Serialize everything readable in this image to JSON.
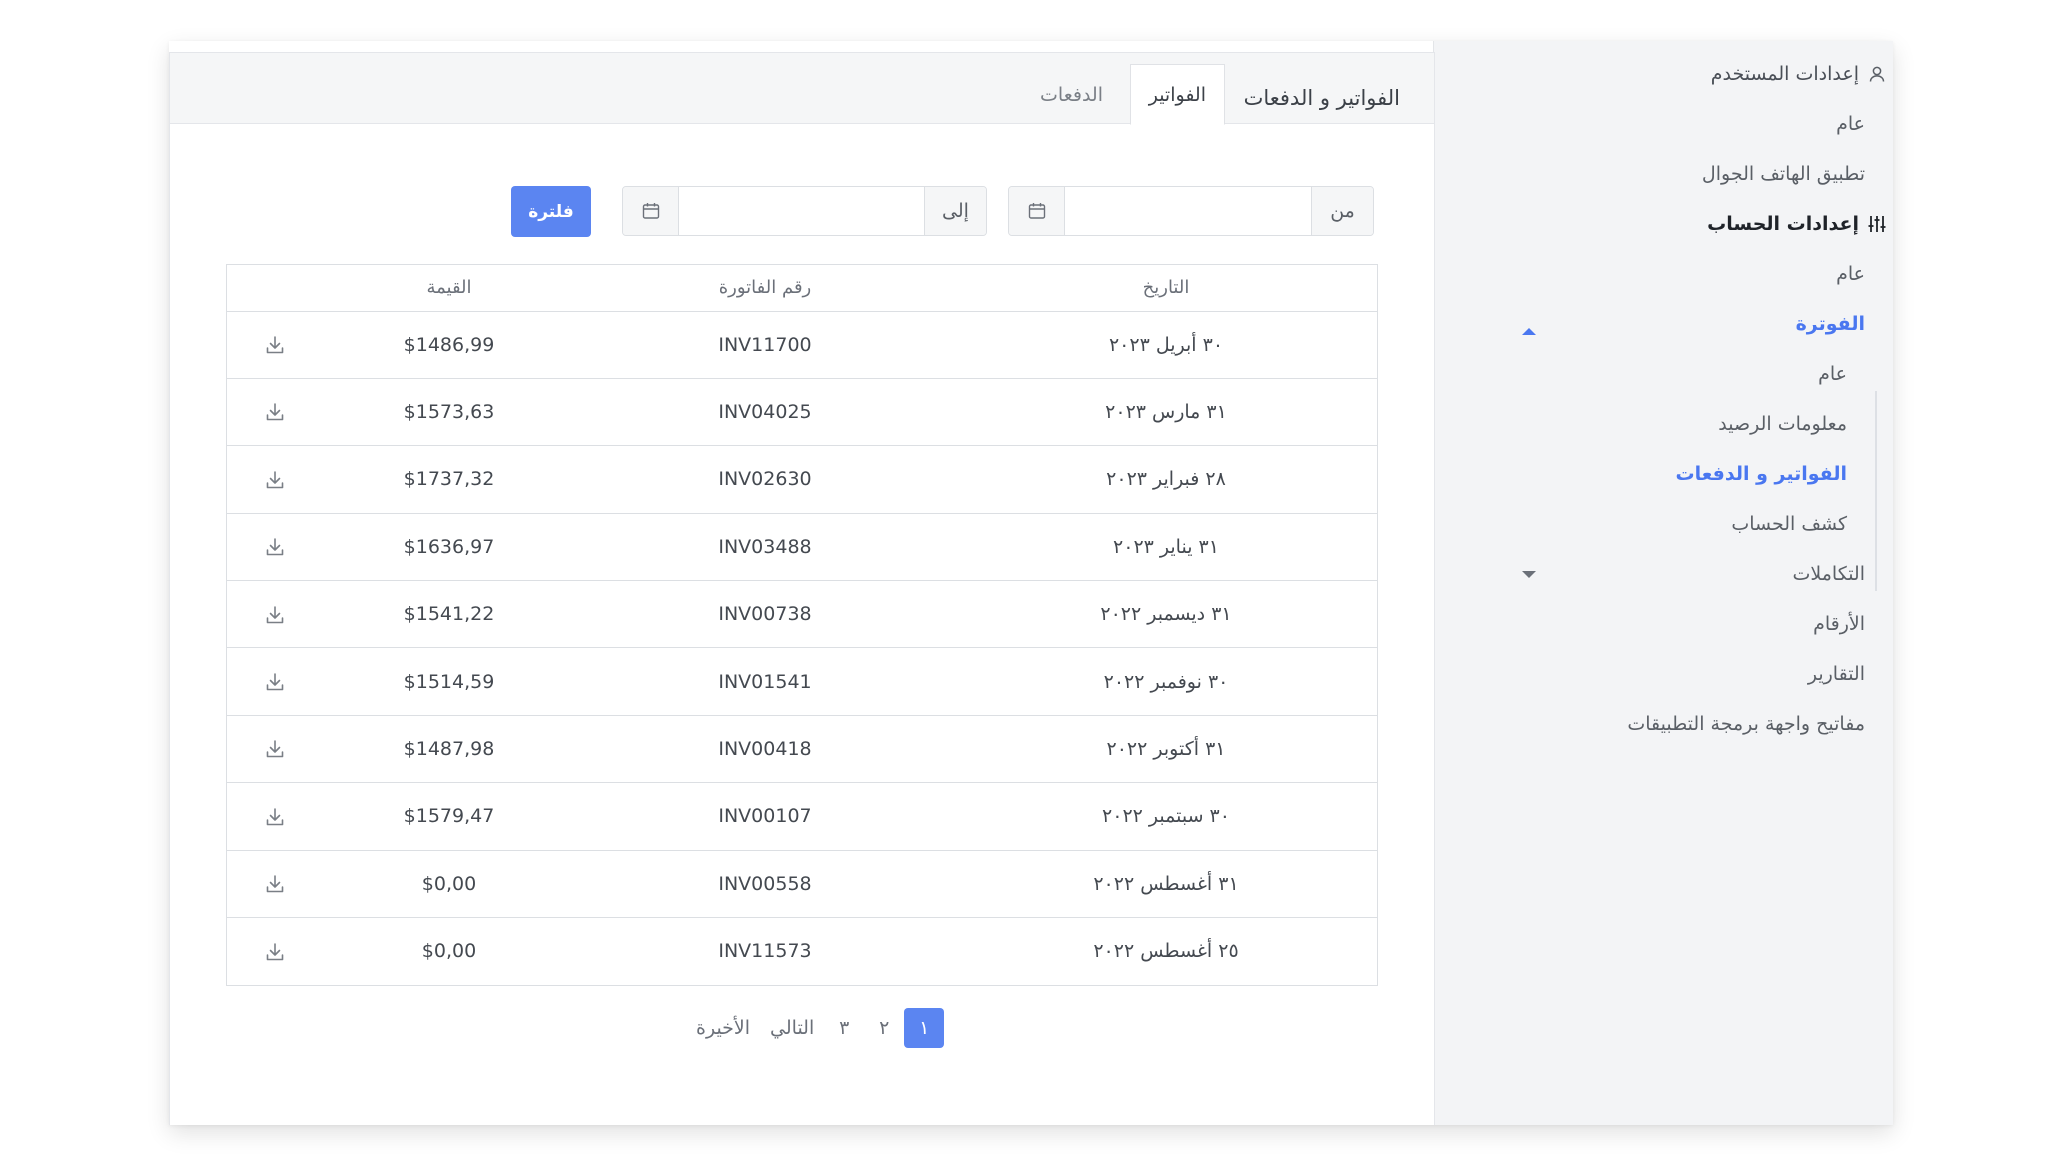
{
  "sidebar": {
    "user_settings": "إعدادات المستخدم",
    "user_general": "عام",
    "mobile_app": "تطبيق الهاتف الجوال",
    "account_settings": "إعدادات الحساب",
    "account_general": "عام",
    "billing": "الفوترة",
    "billing_items": [
      "عام",
      "معلومات الرصيد",
      "الفواتير و الدفعات",
      "كشف الحساب"
    ],
    "integrations": "التكاملات",
    "numbers": "الأرقام",
    "reports": "التقارير",
    "api_keys": "مفاتيح واجهة برمجة التطبيقات"
  },
  "tabs": {
    "title": "الفواتير و الدفعات",
    "invoices": "الفواتير",
    "payments": "الدفعات"
  },
  "filter": {
    "from_label": "من",
    "to_label": "إلى",
    "from_value": "",
    "to_value": "",
    "button_label": "فلترة"
  },
  "table": {
    "headers": {
      "date": "التاريخ",
      "invoice_number": "رقم الفاتورة",
      "amount": "القيمة"
    },
    "rows": [
      {
        "date": "٣٠ أبريل ٢٠٢٣",
        "invoice": "INV11700",
        "amount": "$1486,99"
      },
      {
        "date": "٣١ مارس ٢٠٢٣",
        "invoice": "INV04025",
        "amount": "$1573,63"
      },
      {
        "date": "٢٨ فبراير ٢٠٢٣",
        "invoice": "INV02630",
        "amount": "$1737,32"
      },
      {
        "date": "٣١ يناير ٢٠٢٣",
        "invoice": "INV03488",
        "amount": "$1636,97"
      },
      {
        "date": "٣١ ديسمبر ٢٠٢٢",
        "invoice": "INV00738",
        "amount": "$1541,22"
      },
      {
        "date": "٣٠ نوفمبر ٢٠٢٢",
        "invoice": "INV01541",
        "amount": "$1514,59"
      },
      {
        "date": "٣١ أكتوبر ٢٠٢٢",
        "invoice": "INV00418",
        "amount": "$1487,98"
      },
      {
        "date": "٣٠ سبتمبر ٢٠٢٢",
        "invoice": "INV00107",
        "amount": "$1579,47"
      },
      {
        "date": "٣١ أغسطس ٢٠٢٢",
        "invoice": "INV00558",
        "amount": "$0,00"
      },
      {
        "date": "٢٥ أغسطس ٢٠٢٢",
        "invoice": "INV11573",
        "amount": "$0,00"
      }
    ]
  },
  "pagination": {
    "pages": [
      "١",
      "٢",
      "٣"
    ],
    "current": "١",
    "next": "التالي",
    "last": "الأخيرة"
  },
  "colors": {
    "accent": "#5b85f1",
    "active_text": "#4a77f0",
    "sidebar_bg": "#f3f4f6"
  },
  "icons": [
    "user-icon",
    "sliders-icon",
    "caret-up-icon",
    "caret-down-icon",
    "calendar-icon",
    "download-icon"
  ]
}
